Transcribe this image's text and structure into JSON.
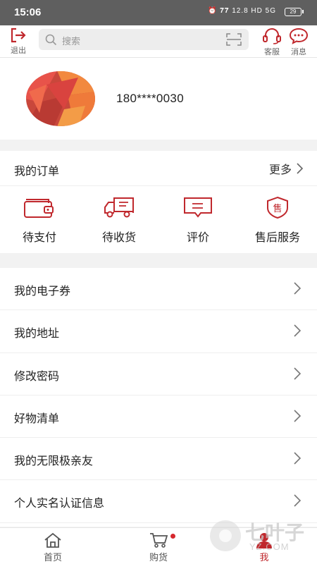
{
  "status_bar": {
    "time": "15:06",
    "indicators": "⏰ 𝟕𝟕 12.8 HD 5G",
    "battery": "29"
  },
  "top_bar": {
    "logout_label": "退出",
    "search_placeholder": "搜索",
    "service_label": "客服",
    "message_label": "消息"
  },
  "profile": {
    "phone": "180****0030"
  },
  "orders": {
    "title": "我的订单",
    "more": "更多",
    "items": [
      {
        "label": "待支付",
        "icon": "wallet-icon"
      },
      {
        "label": "待收货",
        "icon": "delivery-truck-icon"
      },
      {
        "label": "评价",
        "icon": "comment-icon"
      },
      {
        "label": "售后服务",
        "icon": "after-sales-shield-icon"
      }
    ]
  },
  "menu": [
    {
      "label": "我的电子券"
    },
    {
      "label": "我的地址"
    },
    {
      "label": "修改密码"
    },
    {
      "label": "好物清单"
    },
    {
      "label": "我的无限极亲友"
    },
    {
      "label": "个人实名认证信息"
    }
  ],
  "tab_bar": {
    "home": "首页",
    "shop": "购货",
    "me": "我"
  },
  "watermark": {
    "text": "七叶子",
    "sub": "YZ.COM"
  },
  "colors": {
    "accent": "#c0282d",
    "status_bar": "#5f5f5f",
    "background": "#f2f2f2"
  }
}
